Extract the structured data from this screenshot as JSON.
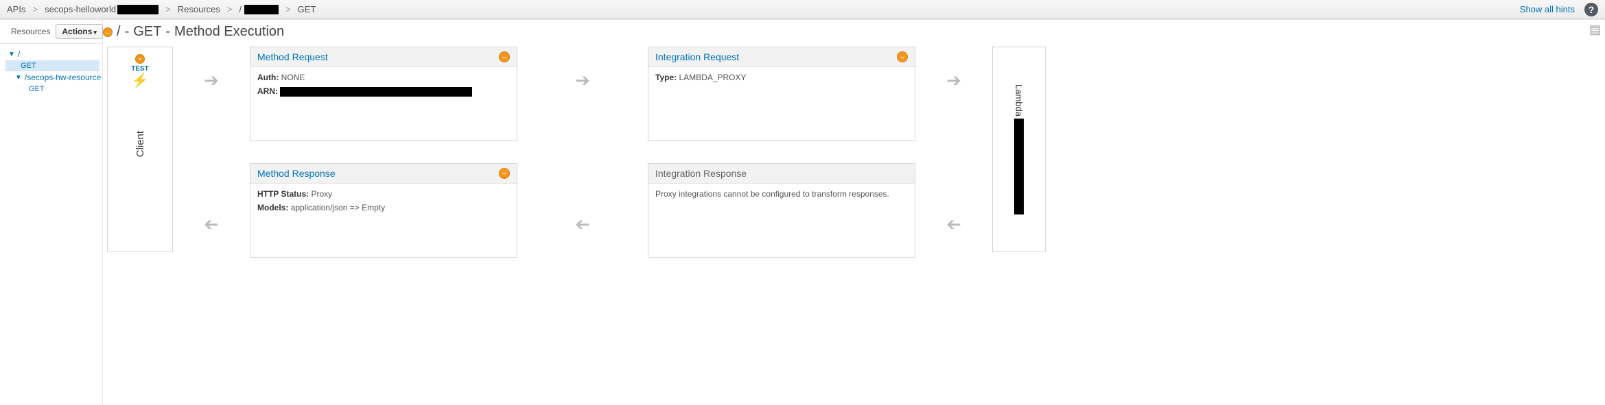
{
  "breadcrumb": {
    "root": "APIs",
    "api_name": "secops-helloworld",
    "resources_label": "Resources",
    "resource_path": "/",
    "method": "GET"
  },
  "top_right": {
    "show_hints": "Show all hints",
    "help_glyph": "?"
  },
  "sidebar": {
    "tab": "Resources",
    "actions_label": "Actions",
    "tree": {
      "root": "/",
      "root_method": "GET",
      "child_path": "/secops-hw-resource",
      "child_method": "GET"
    }
  },
  "title": {
    "path": "/",
    "method": "GET",
    "suffix": "Method Execution"
  },
  "client": {
    "test_label": "TEST",
    "bolt_glyph": "⚡",
    "vertical_label": "Client"
  },
  "method_request": {
    "title": "Method Request",
    "auth_label": "Auth:",
    "auth_value": "NONE",
    "arn_label": "ARN:"
  },
  "method_response": {
    "title": "Method Response",
    "http_status_label": "HTTP Status:",
    "http_status_value": "Proxy",
    "models_label": "Models:",
    "models_value": "application/json => Empty"
  },
  "integration_request": {
    "title": "Integration Request",
    "type_label": "Type:",
    "type_value": "LAMBDA_PROXY"
  },
  "integration_response": {
    "title": "Integration Response",
    "body": "Proxy integrations cannot be configured to transform responses."
  },
  "lambda": {
    "label": "Lambda"
  },
  "arrows": {
    "right": "➔",
    "left": "➔"
  },
  "icons": {
    "minimize": "–",
    "book": "▤"
  }
}
